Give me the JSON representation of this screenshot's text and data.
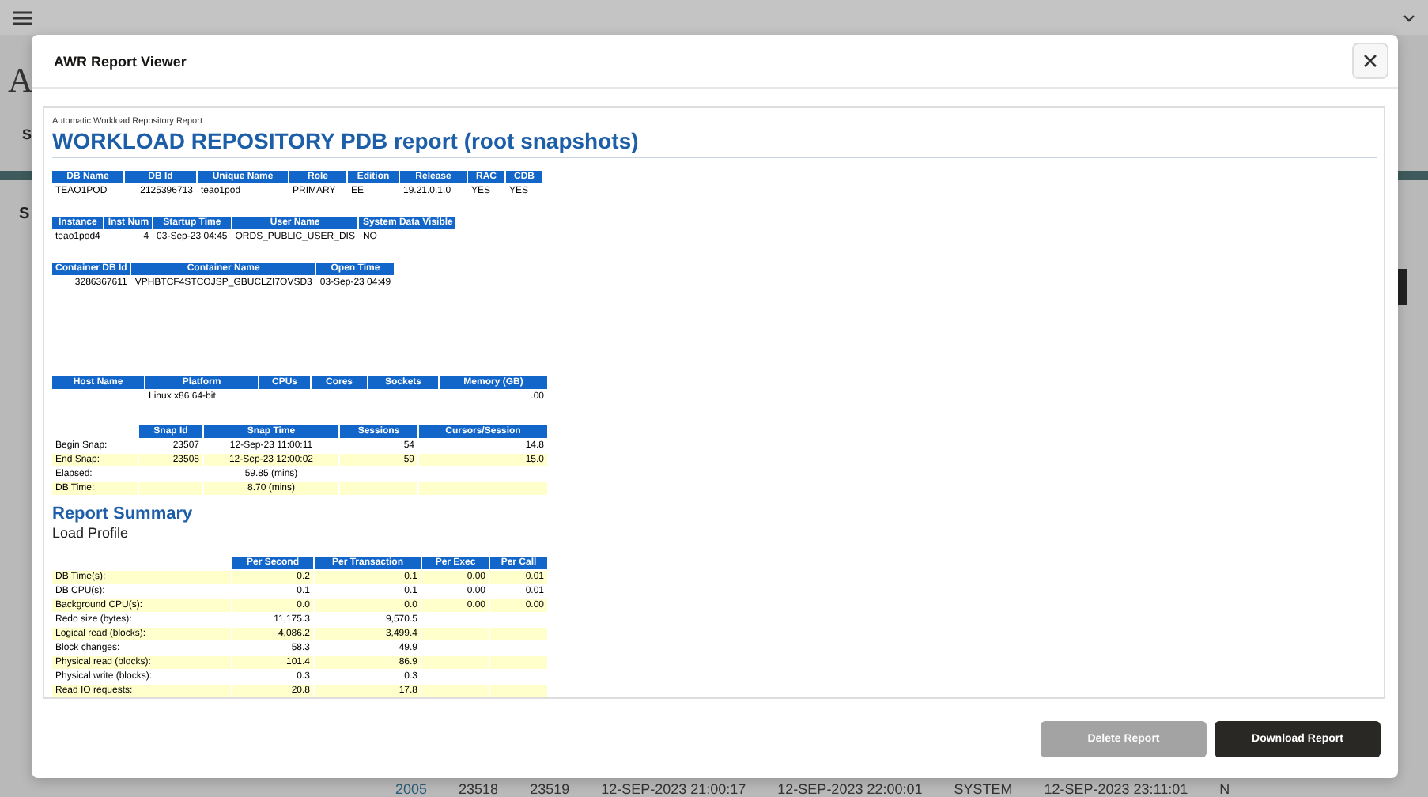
{
  "background": {
    "page_title": "A",
    "tab_label": "S",
    "section_title": "S",
    "table_row": [
      "2005",
      "23518",
      "23519",
      "12-SEP-2023 21:00:17",
      "12-SEP-2023 22:00:01",
      "SYSTEM",
      "12-SEP-2023 23:11:01",
      "N"
    ]
  },
  "dialog": {
    "title": "AWR Report Viewer",
    "report": {
      "blocks": [
        {
          "kind": "caption",
          "text": "Automatic Workload Repository Report"
        },
        {
          "kind": "title",
          "text": "WORKLOAD REPOSITORY PDB report (root snapshots)"
        },
        {
          "kind": "table",
          "columns": [
            "DB Name",
            "DB Id",
            "Unique Name",
            "Role",
            "Edition",
            "Release",
            "RAC",
            "CDB"
          ],
          "rows": [
            {
              "shaded": false,
              "cells": [
                "TEAO1POD",
                "2125396713",
                "teao1pod",
                "PRIMARY",
                "EE",
                "19.21.0.1.0",
                "YES",
                "YES"
              ]
            }
          ]
        },
        {
          "kind": "table",
          "columns": [
            "Instance",
            "Inst Num",
            "Startup Time",
            "User Name",
            "System Data Visible"
          ],
          "rows": [
            {
              "shaded": false,
              "cells": [
                "teao1pod4",
                "4",
                "03-Sep-23 04:45",
                "ORDS_PUBLIC_USER_DIS",
                "NO"
              ]
            }
          ]
        },
        {
          "kind": "table",
          "columns": [
            "Container DB Id",
            "Container Name",
            "Open Time"
          ],
          "rows": [
            {
              "shaded": false,
              "cells": [
                "3286367611",
                "VPHBTCF4STCOJSP_GBUCLZI7OVSD3",
                "03-Sep-23 04:49"
              ]
            }
          ]
        },
        {
          "kind": "table",
          "columns": [
            "Host Name",
            "Platform",
            "CPUs",
            "Cores",
            "Sockets",
            "Memory (GB)"
          ],
          "rows": [
            {
              "shaded": false,
              "cells": [
                null,
                "Linux x86 64-bit",
                null,
                null,
                null,
                ".00"
              ]
            }
          ]
        },
        {
          "kind": "table",
          "columns": [
            null,
            "Snap Id",
            "Snap Time",
            "Sessions",
            "Cursors/Session"
          ],
          "rows": [
            {
              "shaded": false,
              "cells": [
                "Begin Snap:",
                "23507",
                "12-Sep-23 11:00:11",
                "54",
                "14.8"
              ]
            },
            {
              "shaded": true,
              "cells": [
                "End Snap:",
                "23508",
                "12-Sep-23 12:00:02",
                "59",
                "15.0"
              ]
            },
            {
              "shaded": false,
              "cells": [
                "Elapsed:",
                null,
                "59.85 (mins)",
                null,
                null
              ]
            },
            {
              "shaded": true,
              "cells": [
                "DB Time:",
                null,
                "8.70 (mins)",
                null,
                null
              ]
            }
          ]
        },
        {
          "kind": "heading",
          "text": "Report Summary"
        },
        {
          "kind": "subheading",
          "text": "Load Profile"
        },
        {
          "kind": "table",
          "columns": [
            null,
            "Per Second",
            "Per Transaction",
            "Per Exec",
            "Per Call"
          ],
          "rows": [
            {
              "shaded": true,
              "cells": [
                "DB Time(s):",
                "0.2",
                "0.1",
                "0.00",
                "0.01"
              ]
            },
            {
              "shaded": false,
              "cells": [
                "DB CPU(s):",
                "0.1",
                "0.1",
                "0.00",
                "0.01"
              ]
            },
            {
              "shaded": true,
              "cells": [
                "Background CPU(s):",
                "0.0",
                "0.0",
                "0.00",
                "0.00"
              ]
            },
            {
              "shaded": false,
              "cells": [
                "Redo size (bytes):",
                "11,175.3",
                "9,570.5",
                null,
                null
              ]
            },
            {
              "shaded": true,
              "cells": [
                "Logical read (blocks):",
                "4,086.2",
                "3,499.4",
                null,
                null
              ]
            },
            {
              "shaded": false,
              "cells": [
                "Block changes:",
                "58.3",
                "49.9",
                null,
                null
              ]
            },
            {
              "shaded": true,
              "cells": [
                "Physical read (blocks):",
                "101.4",
                "86.9",
                null,
                null
              ]
            },
            {
              "shaded": false,
              "cells": [
                "Physical write (blocks):",
                "0.3",
                "0.3",
                null,
                null
              ]
            },
            {
              "shaded": true,
              "cells": [
                "Read IO requests:",
                "20.8",
                "17.8",
                null,
                null
              ]
            }
          ]
        }
      ]
    },
    "buttons": [
      {
        "label": "Delete Report",
        "disabled": true
      },
      {
        "label": "Download Report",
        "disabled": false
      }
    ]
  }
}
